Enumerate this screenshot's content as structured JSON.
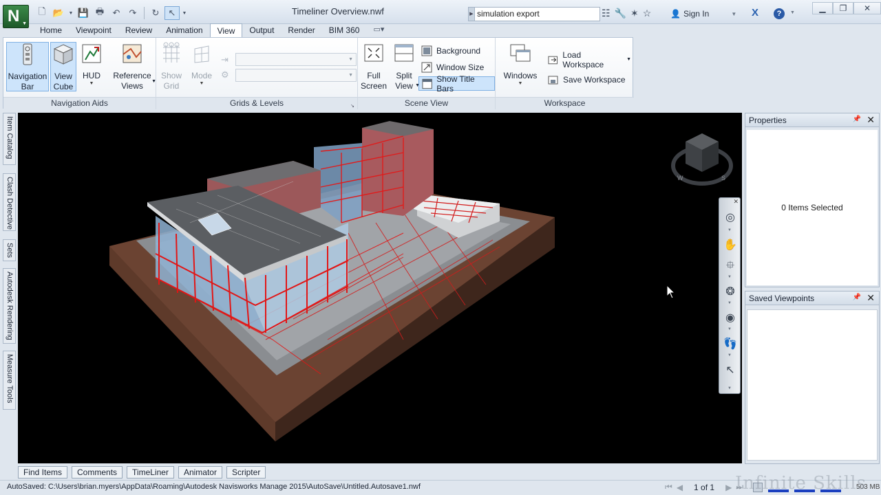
{
  "window": {
    "title": "Timeliner Overview.nwf",
    "app_letter": "N",
    "search_value": "simulation export",
    "sign_in_label": "Sign In"
  },
  "menu_tabs": [
    "Home",
    "Viewpoint",
    "Review",
    "Animation",
    "View",
    "Output",
    "Render",
    "BIM 360"
  ],
  "active_tab": "View",
  "ribbon": {
    "navigation_aids": {
      "title": "Navigation Aids",
      "navigation_bar": [
        "Navigation",
        "Bar"
      ],
      "view_cube": [
        "View",
        "Cube"
      ],
      "hud": "HUD",
      "reference_views": [
        "Reference",
        "Views"
      ]
    },
    "grids_levels": {
      "title": "Grids & Levels",
      "show_grid": [
        "Show",
        "Grid"
      ],
      "mode": "Mode"
    },
    "scene_view": {
      "title": "Scene View",
      "full_screen": [
        "Full",
        "Screen"
      ],
      "split_view": [
        "Split",
        "View"
      ],
      "background": "Background",
      "window_size": "Window Size",
      "show_title_bars": "Show Title Bars"
    },
    "workspace": {
      "title": "Workspace",
      "windows": "Windows",
      "load_workspace": "Load Workspace",
      "save_workspace": "Save Workspace"
    }
  },
  "left_dock_tabs": [
    "Item Catalog",
    "Clash Detective",
    "Sets",
    "Autodesk Rendering",
    "Measure Tools"
  ],
  "properties_panel": {
    "title": "Properties",
    "content": "0 Items Selected"
  },
  "saved_viewpoints_panel": {
    "title": "Saved Viewpoints"
  },
  "viewcube_labels": {
    "west": "W",
    "south": "S"
  },
  "bottom_tabs": [
    "Find Items",
    "Comments",
    "TimeLiner",
    "Animator",
    "Scripter"
  ],
  "status": {
    "autosave_path": "AutoSaved: C:\\Users\\brian.myers\\AppData\\Roaming\\Autodesk Navisworks Manage 2015\\AutoSave\\Untitled.Autosave1.nwf",
    "page": "1 of 1",
    "memory": "503 MB",
    "watermark": "Infinite Skills"
  },
  "colors": {
    "accent_select": "#cde4fb",
    "viewport_bg": "#000000",
    "highlight_red": "#e00000"
  }
}
